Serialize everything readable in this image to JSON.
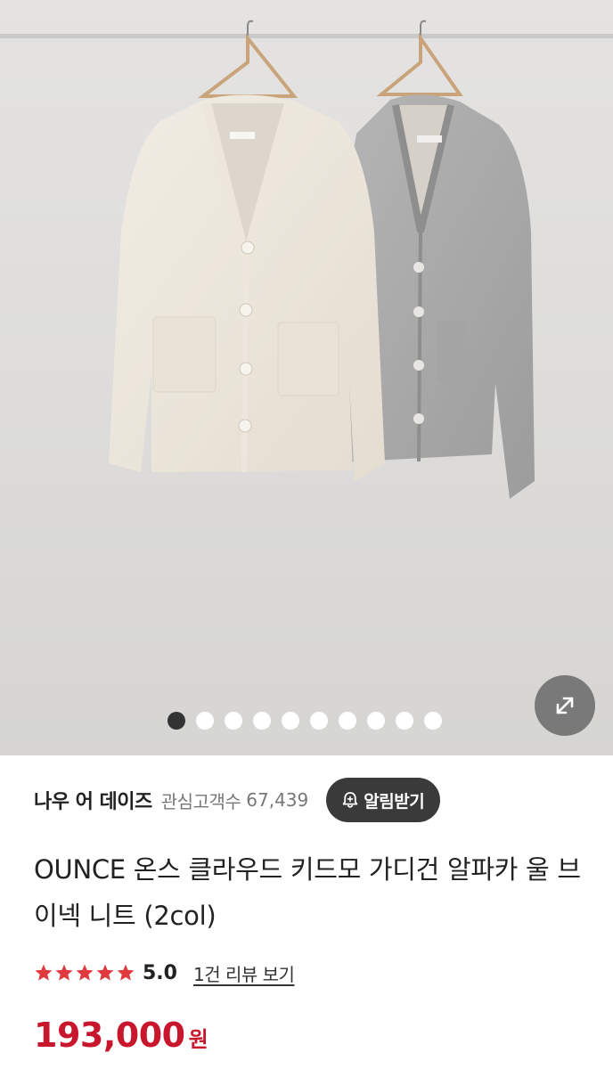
{
  "gallery": {
    "image_alt": "beige and gray v-neck cardigans hanging on a rail",
    "page_count": 10,
    "current_page": 1,
    "expand_icon": "expand-arrows-icon"
  },
  "shop": {
    "name": "나우 어 데이즈",
    "followers_label": "관심고객수",
    "followers_count": "67,439",
    "alarm_icon": "bell-plus-icon",
    "alarm_label": "알림받기"
  },
  "product": {
    "title": "OUNCE 온스 클라우드 키드모 가디건 알파카 울 브이넥 니트 (2col)",
    "rating": {
      "stars": 5,
      "score": "5.0",
      "review_link": "1건 리뷰 보기",
      "star_color": "#e03a3e"
    },
    "price": "193,000",
    "currency": "원",
    "price_color": "#c8172d"
  }
}
